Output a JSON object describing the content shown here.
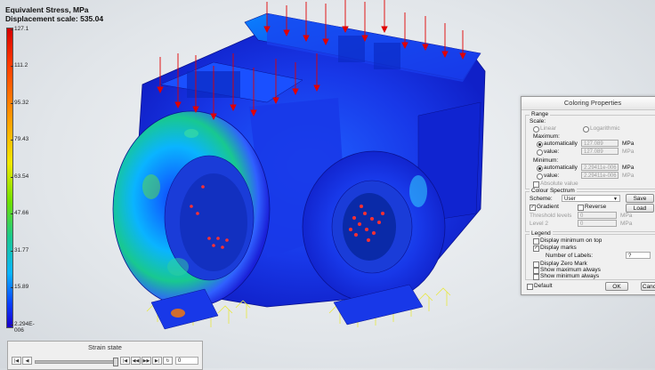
{
  "header": {
    "line1": "Equivalent Stress, MPa",
    "line2": "Displacement scale: 535.04"
  },
  "legend": {
    "ticks": [
      "127.1",
      "111.2",
      "95.32",
      "79.43",
      "63.54",
      "47.66",
      "31.77",
      "15.89",
      "2.294E-006"
    ]
  },
  "dialog": {
    "title": "Coloring Properties",
    "range": {
      "label": "Range",
      "scale_label": "Scale:",
      "linear": "Linear",
      "logarithmic": "Logarithmic",
      "maximum_label": "Maximum:",
      "max_auto": "automatically",
      "max_auto_value": "127.089",
      "max_value_label": "value:",
      "max_value_value": "127.089",
      "minimum_label": "Minimum:",
      "min_auto": "automatically",
      "min_auto_value": "2.29411e-006",
      "min_value_label": "value:",
      "min_value_value": "2.29411e-006",
      "unit": "MPa",
      "absolute_value": "Absolute value"
    },
    "spectrum": {
      "label": "Colour Spectrum",
      "scheme_label": "Scheme:",
      "scheme_value": "User",
      "save": "Save",
      "gradient": "Gradient",
      "reverse": "Reverse",
      "load": "Load",
      "threshold_label": "Threshold levels",
      "threshold_value": "0",
      "threshold_unit": "MPa",
      "level_label": "Level 2",
      "level_value": "0",
      "level_unit": "MPa"
    },
    "legend_group": {
      "label": "Legend",
      "display_min_top": "Display minimum on top",
      "display_marks": "Display marks",
      "number_of_labels": "Number of Labels:",
      "number_value": "?",
      "display_zero": "Display Zero Mark",
      "show_max": "Show maximum always",
      "show_min": "Show minimum always"
    },
    "default_label": "Default",
    "ok": "OK",
    "cancel": "Cancel"
  },
  "strain": {
    "title": "Strain state",
    "value": "0"
  },
  "colors": {
    "stress_max": "#d40000",
    "stress_mid": "#f2e800",
    "stress_low": "#18c890",
    "stress_min": "#1a00c8",
    "arrow": "#e00000"
  }
}
